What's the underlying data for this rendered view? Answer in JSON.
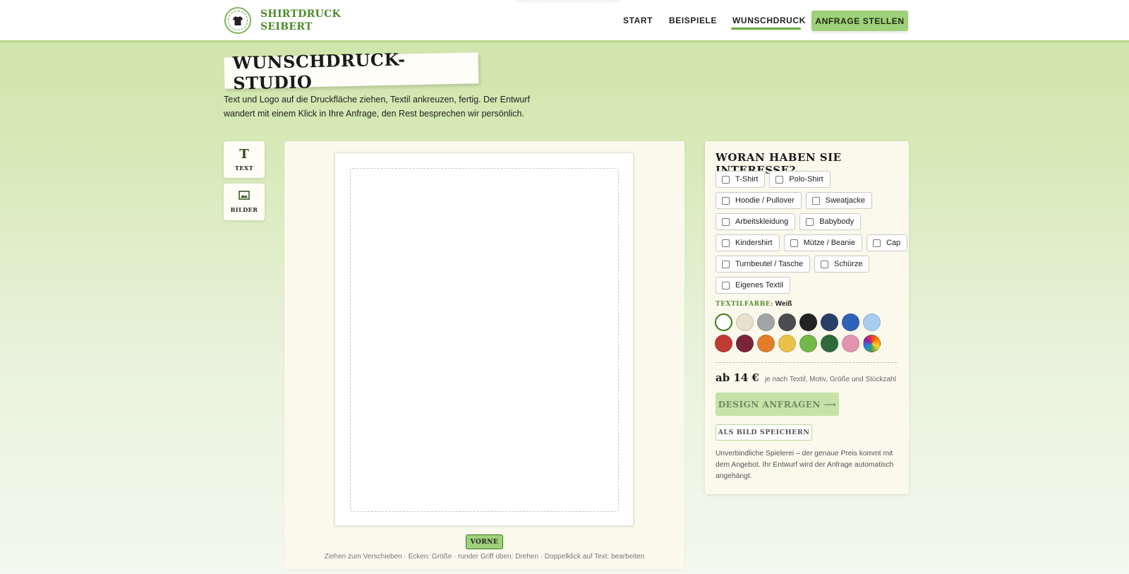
{
  "header": {
    "brand_line1": "SHIRTDRUCK",
    "brand_line2": "SEIBERT",
    "logo_icon": "tshirt-icon",
    "nav": [
      {
        "label": "START"
      },
      {
        "label": "BEISPIELE"
      },
      {
        "label": "WUNSCHDRUCK",
        "active": true
      }
    ],
    "cta_label": "ANFRAGE STELLEN"
  },
  "page": {
    "title": "WUNSCHDRUCK-STUDIO",
    "intro_line1": "Text und Logo auf die Druckfläche ziehen, Textil ankreuzen, fertig. Der Entwurf",
    "intro_line2": "wandert mit einem Klick in Ihre Anfrage, den Rest besprechen wir persönlich."
  },
  "tools": [
    {
      "label": "TEXT",
      "icon": "text-icon",
      "glyph": "T"
    },
    {
      "label": "BILDER",
      "icon": "image-icon"
    }
  ],
  "canvas": {
    "side_label": "VORNE",
    "hint": "Ziehen zum Verschieben · Ecken: Größe · runder Griff oben: Drehen · Doppelklick auf Text: bearbeiten"
  },
  "interest": {
    "title": "WORAN HABEN SIE INTERESSE?",
    "rows": [
      [
        "T-Shirt",
        "Polo-Shirt"
      ],
      [
        "Hoodie / Pullover",
        "Sweatjacke"
      ],
      [
        "Arbeitskleidung",
        "Babybody"
      ],
      [
        "Kindershirt",
        "Mütze / Beanie",
        "Cap"
      ],
      [
        "Turnbeutel / Tasche",
        "Schürze"
      ],
      [
        "Eigenes Textil"
      ]
    ],
    "color_label": "TEXTILFARBE:",
    "color_value": "Weiß",
    "colors_row1": [
      "#ffffff",
      "#e8e1cf",
      "#a3a4a6",
      "#4b4c4f",
      "#232323",
      "#2a3f66",
      "#2f63b9",
      "#a9cdee"
    ],
    "colors_row2": [
      "#c03a36",
      "#7a2438",
      "#e47d2a",
      "#e8c24a",
      "#72b84a",
      "#2f6a3c",
      "#e394ae",
      "multicolor"
    ],
    "price_amount": "ab 14 €",
    "price_note": "je nach Textil, Motiv, Größe und Stückzahl",
    "request_label": "DESIGN ANFRAGEN ⟶",
    "save_label": "ALS BILD SPEICHERN",
    "disclaimer": "Unverbindliche Spielerei – der genaue Preis kommt mit dem Angebot. Ihr Entwurf wird der Anfrage automatisch angehängt."
  }
}
